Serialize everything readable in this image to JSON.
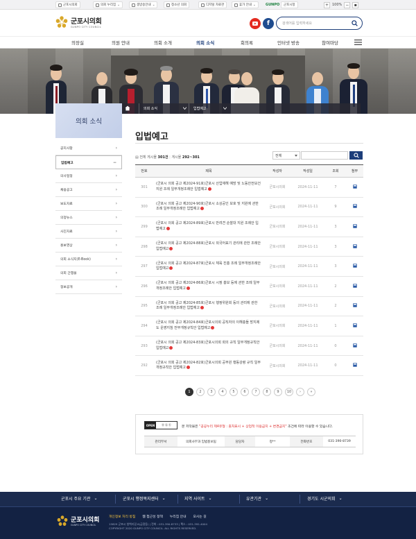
{
  "util": {
    "items": [
      "군포시의회",
      "의회 누리집",
      "생방송안내",
      "청소년 의회",
      "디지털 자료관",
      "휴가 안내",
      "군포시청"
    ],
    "gunpo_logo": "GUNPO",
    "zoom": "100%"
  },
  "header": {
    "logo_title": "군포시의회",
    "logo_sub": "GUNPO CITY COUNCIL",
    "search_placeholder": "검색어를 입력하세요"
  },
  "gnb": {
    "menus": [
      "의장실",
      "의원 안내",
      "의회 소개",
      "의회 소식",
      "회의록",
      "인터넷 방송",
      "참여마당"
    ],
    "active_index": 3
  },
  "location": {
    "seg1": "의회 소식",
    "seg2": "입법예고"
  },
  "side": {
    "title": "의회 소식",
    "items": [
      "공지사항",
      "입법예고",
      "의사일정",
      "채용공고",
      "보도자료",
      "의정뉴스",
      "사진자료",
      "홍보영상",
      "의회 소식지(E-Book)",
      "의회 간행물",
      "정보공개"
    ],
    "active_index": 1
  },
  "content": {
    "title": "입법예고",
    "total_label": "전체 게시물",
    "total_value": "301건",
    "page_label": "게시물",
    "page_value": "292~301",
    "select_value": "전체"
  },
  "table": {
    "headers": [
      "번호",
      "제목",
      "작성자",
      "작성일",
      "조회",
      "첨부"
    ],
    "rows": [
      {
        "no": "301",
        "title": "(군포시 의회 공고 제2024-91호)군포시 산업재해 예방 및 노동안전보건 지원 조례 일부개정조례안 입법예고",
        "author": "군포시의회",
        "date": "2024-11-11",
        "views": "7"
      },
      {
        "no": "300",
        "title": "(군포시 의회 공고 제2024-90호)군포시 소상공인 보호 및 지원에 관한 조례 일부개정조례안 입법예고",
        "author": "군포시의회",
        "date": "2024-11-11",
        "views": "9"
      },
      {
        "no": "299",
        "title": "(군포시 의회 공고 제2024-89호)군포시 반려견 순찰대 지원 조례안 입법예고",
        "author": "군포시의회",
        "date": "2024-11-11",
        "views": "3"
      },
      {
        "no": "298",
        "title": "(군포시 의회 공고 제2024-88호)군포시 외국어표기 관리에 관한 조례안 입법예고",
        "author": "군포시의회",
        "date": "2024-11-11",
        "views": "3"
      },
      {
        "no": "297",
        "title": "(군포시 의회 공고 제2024-87호)군포시 체육 진흥 조례 일부개정조례안 입법예고",
        "author": "군포시의회",
        "date": "2024-11-11",
        "views": "3"
      },
      {
        "no": "296",
        "title": "(군포시 의회 공고 제2024-86호)군포시 시정 홍보 등에 관한 조례 일부개정조례안 입법예고",
        "author": "군포시의회",
        "date": "2024-11-11",
        "views": "2"
      },
      {
        "no": "295",
        "title": "(군포시 의회 공고 제2024-85호)군포시 행정위원회 등의 관리에 관한 조례 일부개정조례안 입법예고",
        "author": "군포시의회",
        "date": "2024-11-11",
        "views": "2"
      },
      {
        "no": "294",
        "title": "(군포시 의회 공고 제2024-84호)군포시의회 공직자의 이해충돌 방지제도 운영지침 전부개정규칙안 입법예고",
        "author": "군포시의회",
        "date": "2024-11-11",
        "views": "1"
      },
      {
        "no": "293",
        "title": "(군포시 의회 공고 제2024-83호)군포시의회 회의 규칙 일부개정규칙안 입법예고",
        "author": "군포시의회",
        "date": "2024-11-11",
        "views": "0"
      },
      {
        "no": "292",
        "title": "(군포시 의회 공고 제2024-82호)군포시의회 공무원 행동강령 규칙 일부개정규칙안 입법예고",
        "author": "군포시의회",
        "date": "2024-11-11",
        "views": "0"
      }
    ]
  },
  "pagination": {
    "pages": [
      "1",
      "2",
      "3",
      "4",
      "5",
      "6",
      "7",
      "8",
      "9",
      "10"
    ],
    "current": "1",
    "next": "›",
    "last": "»"
  },
  "info": {
    "ogl_text": "OPEN",
    "message_pre": "본 저작물은 ",
    "message_red": "\"공공누리 제4유형 : 출처표시 + 상업적 이용금지 + 변경금지\"",
    "message_post": " 조건에 따라 이용할 수 있습니다.",
    "dept_label": "관리부서",
    "dept_value": "의회사무과 입법홍보팀",
    "manager_label": "담당자",
    "manager_value": "정**",
    "phone_label": "전화번호",
    "phone_value": "031-390-8739"
  },
  "footer": {
    "nav": [
      "군포시 주요 기관",
      "군포시 행정복지센터",
      "지역 사이트",
      "유관기관",
      "경기도 시군의회"
    ],
    "logo_title": "군포시의회",
    "logo_sub": "GUNPO CITY COUNCIL",
    "links": [
      "개인정보 처리 방침",
      "웹 접근성 정책",
      "누리집 안내",
      "오시는 길"
    ],
    "address": "15829 군포시 청백리길 6(금정동) | 전화 : 031-390-8733 | 팩스 : 031-392-4004",
    "copyright": "COPYRIGHT 2020 GUNPO CITY COUNCIL. ALL RIGHTS RESERVED."
  },
  "colors": {
    "brand": "#1d3e7a",
    "footer_bg": "#132243",
    "new_badge": "#e43a3a"
  }
}
